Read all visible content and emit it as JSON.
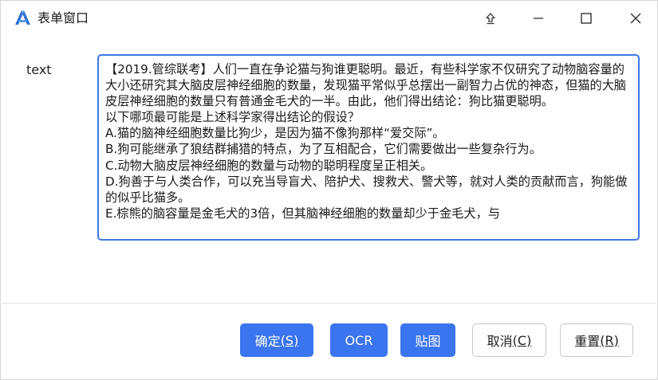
{
  "window": {
    "title": "表单窗口",
    "controls": {
      "pin_icon": "pin-top-icon",
      "minimize_icon": "minimize-icon",
      "maximize_icon": "maximize-icon",
      "close_icon": "close-icon"
    }
  },
  "form": {
    "field_label": "text",
    "text_value": "【2019.管综联考】人们一直在争论猫与狗谁更聪明。最近，有些科学家不仅研究了动物脑容量的大小还研究其大脑皮层神经细胞的数量，发现猫平常似乎总摆出一副智力占优的神态，但猫的大脑皮层神经细胞的数量只有普通金毛犬的一半。由此，他们得出结论：狗比猫更聪明。\n以下哪项最可能是上述科学家得出结论的假设？\nA.猫的脑神经细胞数量比狗少，是因为猫不像狗那样“爱交际”。\nB.狗可能继承了狼结群捕猎的特点，为了互相配合，它们需要做出一些复杂行为。\nC.动物大脑皮层神经细胞的数量与动物的聪明程度呈正相关。\nD.狗善于与人类合作，可以充当导盲犬、陪护犬、搜救犬、警犬等，就对人类的贡献而言，狗能做的似乎比猫多。\nE.棕熊的脑容量是金毛犬的3倍，但其脑神经细胞的数量却少于金毛犬，与"
  },
  "buttons": {
    "ok": {
      "label": "确定",
      "shortcut": "(S)"
    },
    "ocr": {
      "label": "OCR"
    },
    "paste": {
      "label": "贴图"
    },
    "cancel": {
      "label": "取消",
      "shortcut": "(C)"
    },
    "reset": {
      "label": "重置",
      "shortcut": "(R)"
    }
  },
  "colors": {
    "accent": "#3a74ee",
    "focus_border": "#3e78e6"
  }
}
